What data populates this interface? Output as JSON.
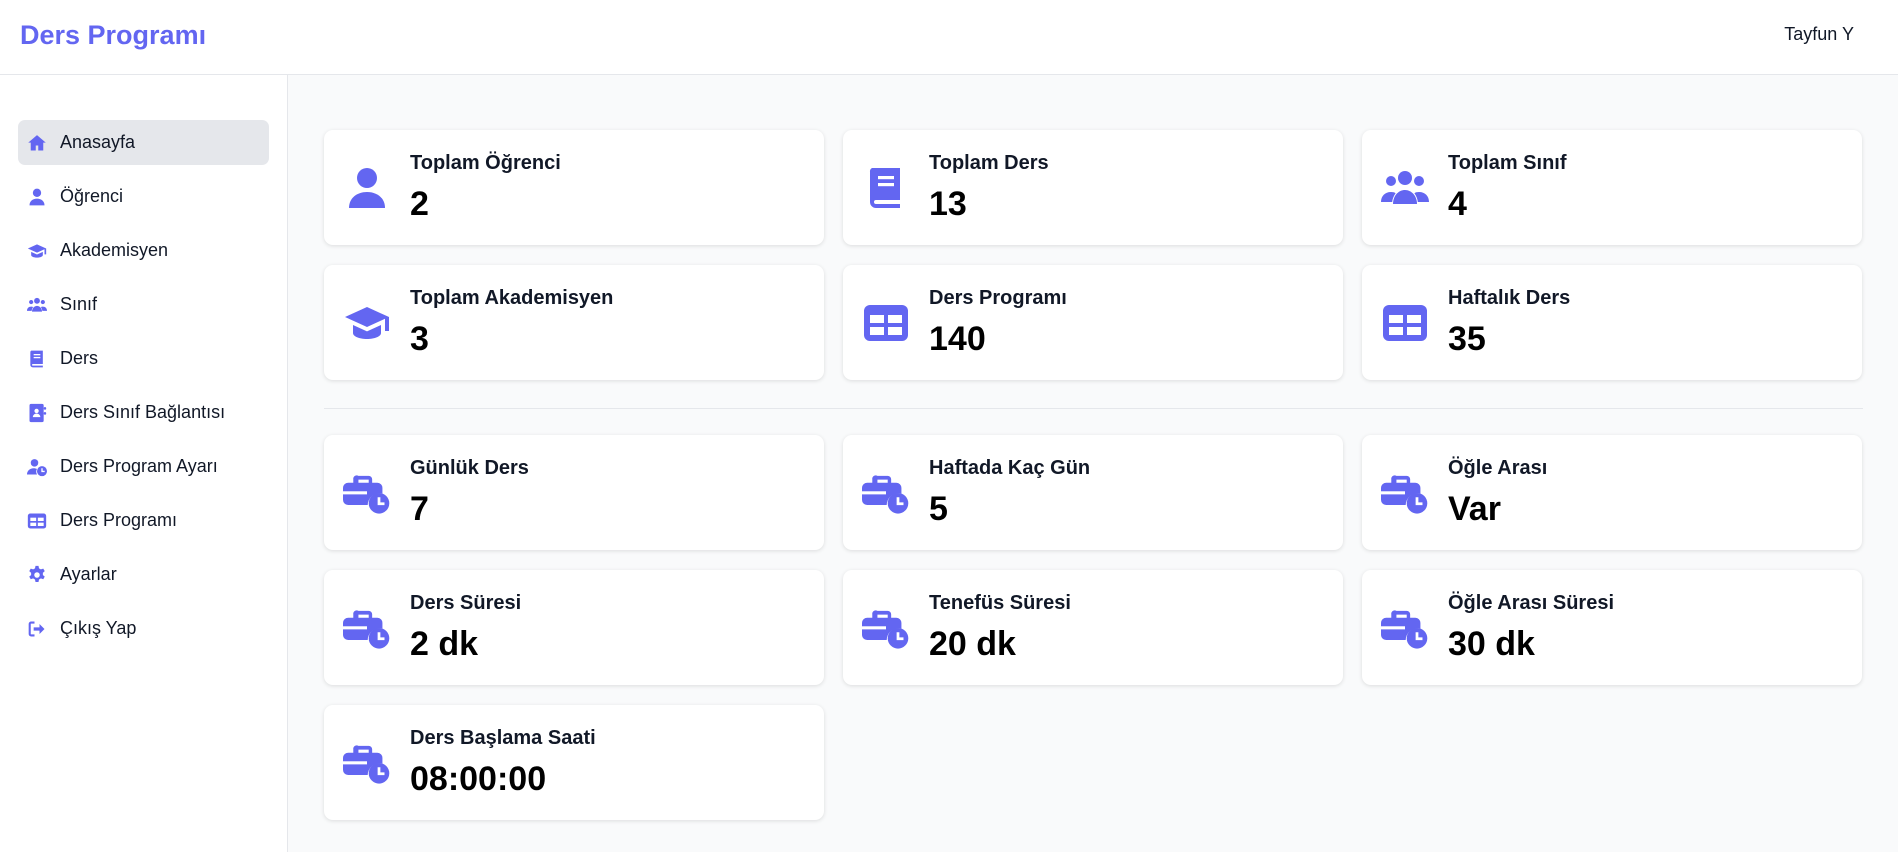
{
  "app": {
    "title": "Ders Programı",
    "user": "Tayfun Y"
  },
  "sidebar": {
    "items": [
      {
        "label": "Anasayfa",
        "icon": "home-icon"
      },
      {
        "label": "Öğrenci",
        "icon": "user-icon"
      },
      {
        "label": "Akademisyen",
        "icon": "graduation-cap-icon"
      },
      {
        "label": "Sınıf",
        "icon": "users-icon"
      },
      {
        "label": "Ders",
        "icon": "book-icon"
      },
      {
        "label": "Ders Sınıf Bağlantısı",
        "icon": "address-book-icon"
      },
      {
        "label": "Ders Program Ayarı",
        "icon": "user-clock-icon"
      },
      {
        "label": "Ders Programı",
        "icon": "table-icon"
      },
      {
        "label": "Ayarlar",
        "icon": "gear-icon"
      },
      {
        "label": "Çıkış Yap",
        "icon": "logout-icon"
      }
    ]
  },
  "stats": [
    {
      "label": "Toplam Öğrenci",
      "value": "2",
      "icon": "user-icon"
    },
    {
      "label": "Toplam Ders",
      "value": "13",
      "icon": "book-icon"
    },
    {
      "label": "Toplam Sınıf",
      "value": "4",
      "icon": "users-icon"
    },
    {
      "label": "Toplam Akademisyen",
      "value": "3",
      "icon": "graduation-cap-icon"
    },
    {
      "label": "Ders Programı",
      "value": "140",
      "icon": "table-icon"
    },
    {
      "label": "Haftalık Ders",
      "value": "35",
      "icon": "table-icon"
    }
  ],
  "settings": [
    {
      "label": "Günlük Ders",
      "value": "7",
      "icon": "business-time-icon"
    },
    {
      "label": "Haftada Kaç Gün",
      "value": "5",
      "icon": "business-time-icon"
    },
    {
      "label": "Öğle Arası",
      "value": "Var",
      "icon": "business-time-icon"
    },
    {
      "label": "Ders Süresi",
      "value": "2 dk",
      "icon": "business-time-icon"
    },
    {
      "label": "Tenefüs Süresi",
      "value": "20 dk",
      "icon": "business-time-icon"
    },
    {
      "label": "Öğle Arası Süresi",
      "value": "30 dk",
      "icon": "business-time-icon"
    },
    {
      "label": "Ders Başlama Saati",
      "value": "08:00:00",
      "icon": "business-time-icon"
    }
  ],
  "colors": {
    "accent": "#6366f1",
    "active_bg": "#e5e7eb",
    "page_bg": "#f9fafb"
  }
}
